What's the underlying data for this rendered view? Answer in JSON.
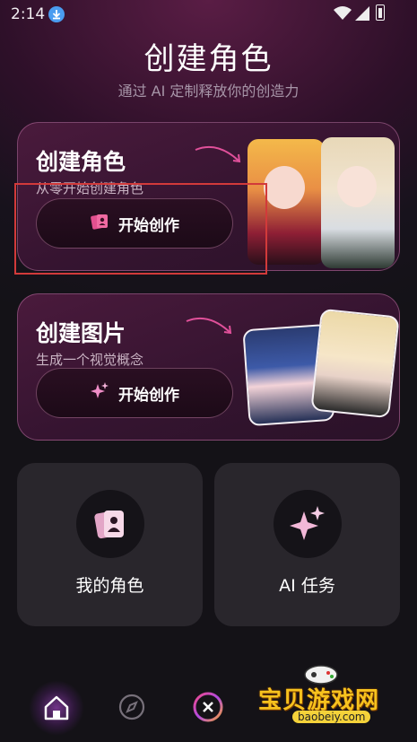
{
  "status_bar": {
    "time": "2:14"
  },
  "header": {
    "title": "创建角色",
    "subtitle": "通过 AI 定制释放你的创造力"
  },
  "cards": [
    {
      "title": "创建角色",
      "subtitle": "从零开始创建角色",
      "button_label": "开始创作"
    },
    {
      "title": "创建图片",
      "subtitle": "生成一个视觉概念",
      "button_label": "开始创作"
    }
  ],
  "tiles": [
    {
      "label": "我的角色",
      "icon": "character-card-icon"
    },
    {
      "label": "AI 任务",
      "icon": "sparkle-icon"
    }
  ],
  "bottom_nav": {
    "items": [
      "home-icon",
      "compass-icon",
      "close-icon"
    ]
  },
  "watermark": {
    "text": "宝贝游戏网",
    "url": "baobeiy.com"
  },
  "colors": {
    "accent": "#e0509a",
    "card_bg": "#351430",
    "tile_bg": "#29262c",
    "highlight_box": "#d23a3a"
  }
}
